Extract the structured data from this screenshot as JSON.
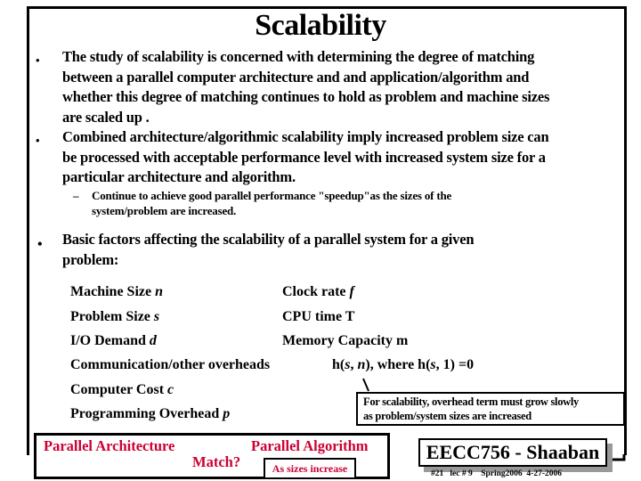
{
  "slide": {
    "title": "Scalability",
    "bullets": [
      {
        "lines": [
          "The study of scalability is concerned with determining the degree of matching",
          "between a parallel computer architecture and and application/algorithm and",
          "whether this degree of matching continues to hold as problem and machine sizes",
          "are scaled up ."
        ]
      },
      {
        "lines": [
          "Combined architecture/algorithmic scalability imply  increased problem size can",
          "be processed with acceptable performance level with increased system size for a",
          "particular architecture and algorithm."
        ],
        "sub": {
          "marker": "–",
          "lines": [
            "Continue to achieve good parallel performance \"speedup\"as the sizes of the",
            "system/problem are increased."
          ]
        }
      },
      {
        "lines": [
          "Basic factors affecting the scalability of a parallel system for a given",
          "problem:"
        ]
      }
    ],
    "bullet_marker": "•",
    "factors_left": [
      {
        "label": "Machine Size ",
        "var": "n"
      },
      {
        "label": "Problem Size ",
        "var": "s"
      },
      {
        "label": "I/O Demand ",
        "var": "d"
      },
      {
        "label": "Communication/other overheads",
        "var": ""
      },
      {
        "label": "Computer Cost ",
        "var": "c"
      },
      {
        "label": "Programming Overhead ",
        "var": "p"
      }
    ],
    "factors_right": [
      {
        "label": "Clock rate ",
        "var": "f"
      },
      {
        "label": "CPU time  T",
        "var": ""
      },
      {
        "label": "Memory Capacity  m",
        "var": ""
      }
    ],
    "overhead_formula": {
      "h_open": "h(",
      "s": "s",
      "comma": ", ",
      "n": "n",
      "close": "),   where  h(",
      "s2": "s",
      "tail": ", 1) =0"
    },
    "overhead_note": [
      "For scalability, overhead term must grow slowly",
      "as  problem/system sizes are increased"
    ],
    "match": {
      "left": "Parallel Architecture",
      "right": "Parallel Algorithm",
      "question": "Match?",
      "note": "As sizes increase"
    },
    "footer": {
      "course": "EECC756 - Shaaban",
      "info": "#21   lec # 9    Spring2006  4-27-2006"
    },
    "colors": {
      "accent_red": "#cc0033",
      "text": "#000000",
      "shadow": "#999999"
    }
  }
}
